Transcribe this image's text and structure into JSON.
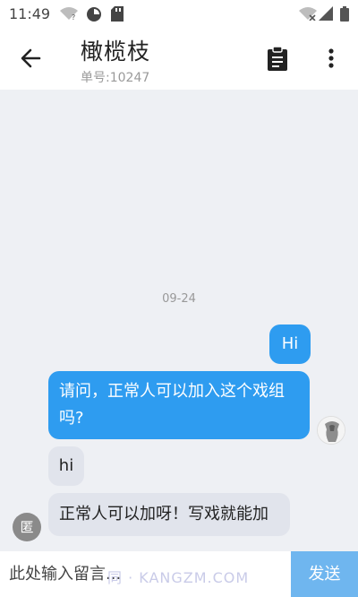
{
  "status_bar": {
    "time": "11:49",
    "left_icons": [
      "wifi-question-icon",
      "data-saver-icon",
      "sd-card-icon"
    ],
    "right_icons": [
      "wifi-off-icon",
      "cell-signal-icon",
      "battery-icon"
    ]
  },
  "app_bar": {
    "back_icon": "arrow-left-icon",
    "title": "橄榄枝",
    "order_number": "单号:10247",
    "actions": [
      "clipboard-icon",
      "more-vert-icon"
    ]
  },
  "chat": {
    "date_separator": "09-24",
    "messages": [
      {
        "direction": "outgoing",
        "text": "Hi"
      },
      {
        "direction": "outgoing",
        "text": "请问，正常人可以加入这个戏组吗?"
      },
      {
        "direction": "incoming",
        "text": "hi"
      },
      {
        "direction": "incoming",
        "text": "正常人可以加呀！写戏就能加"
      }
    ],
    "staff_avatar_text": "匿"
  },
  "composer": {
    "placeholder": "此处输入留言...",
    "watermark": "同 · KANGZM.COM",
    "send_label": "发送"
  },
  "colors": {
    "accent": "#2e9cf0",
    "send_button": "#6fb6ef",
    "background": "#eef0f4"
  }
}
